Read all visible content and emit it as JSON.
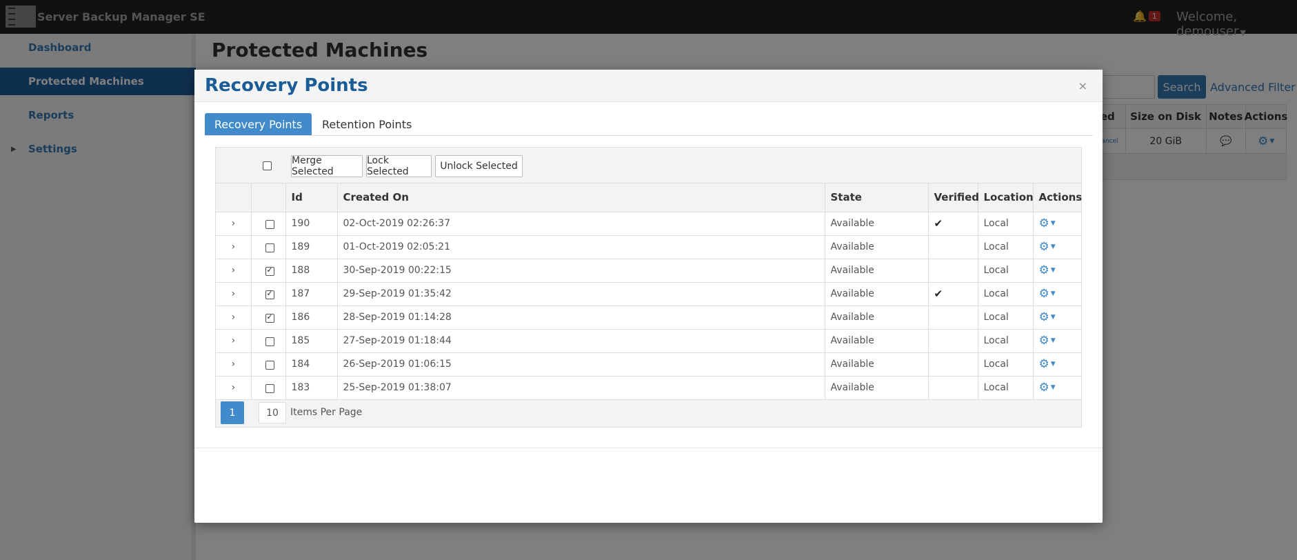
{
  "app": {
    "brand": "Server Backup Manager SE",
    "notification_count": "1",
    "welcome": "Welcome, demouser"
  },
  "sidebar": {
    "items": [
      {
        "label": "Dashboard"
      },
      {
        "label": "Protected Machines"
      },
      {
        "label": "Reports"
      },
      {
        "label": "Settings"
      }
    ]
  },
  "main": {
    "title": "Protected Machines",
    "search_label": "Search",
    "advanced_filter": "Advanced Filter",
    "table_headers": [
      "ed",
      "Size on Disk",
      "Notes",
      "Actions"
    ],
    "row": {
      "partial": "Cancel",
      "size": "20 GiB"
    }
  },
  "modal": {
    "title": "Recovery Points",
    "close": "×",
    "tabs": [
      {
        "label": "Recovery Points",
        "active": true
      },
      {
        "label": "Retention Points",
        "active": false
      }
    ],
    "toolbar": {
      "merge": "Merge Selected",
      "lock": "Lock Selected",
      "unlock": "Unlock Selected"
    },
    "columns": [
      "Id",
      "Created On",
      "State",
      "Verified",
      "Location",
      "Actions"
    ],
    "rows": [
      {
        "id": "190",
        "created": "02-Oct-2019 02:26:37",
        "state": "Available",
        "verified": true,
        "location": "Local",
        "checked": false
      },
      {
        "id": "189",
        "created": "01-Oct-2019 02:05:21",
        "state": "Available",
        "verified": false,
        "location": "Local",
        "checked": false
      },
      {
        "id": "188",
        "created": "30-Sep-2019 00:22:15",
        "state": "Available",
        "verified": false,
        "location": "Local",
        "checked": true
      },
      {
        "id": "187",
        "created": "29-Sep-2019 01:35:42",
        "state": "Available",
        "verified": true,
        "location": "Local",
        "checked": true
      },
      {
        "id": "186",
        "created": "28-Sep-2019 01:14:28",
        "state": "Available",
        "verified": false,
        "location": "Local",
        "checked": true
      },
      {
        "id": "185",
        "created": "27-Sep-2019 01:18:44",
        "state": "Available",
        "verified": false,
        "location": "Local",
        "checked": false
      },
      {
        "id": "184",
        "created": "26-Sep-2019 01:06:15",
        "state": "Available",
        "verified": false,
        "location": "Local",
        "checked": false
      },
      {
        "id": "183",
        "created": "25-Sep-2019 01:38:07",
        "state": "Available",
        "verified": false,
        "location": "Local",
        "checked": false
      }
    ],
    "pager": {
      "current_page": "1",
      "per_page": "10",
      "per_page_label": "Items Per Page"
    }
  },
  "colors": {
    "accent": "#428bca",
    "title_blue": "#1a5c96",
    "topbar": "#222222",
    "sidebar_active": "#1f5f9e"
  }
}
